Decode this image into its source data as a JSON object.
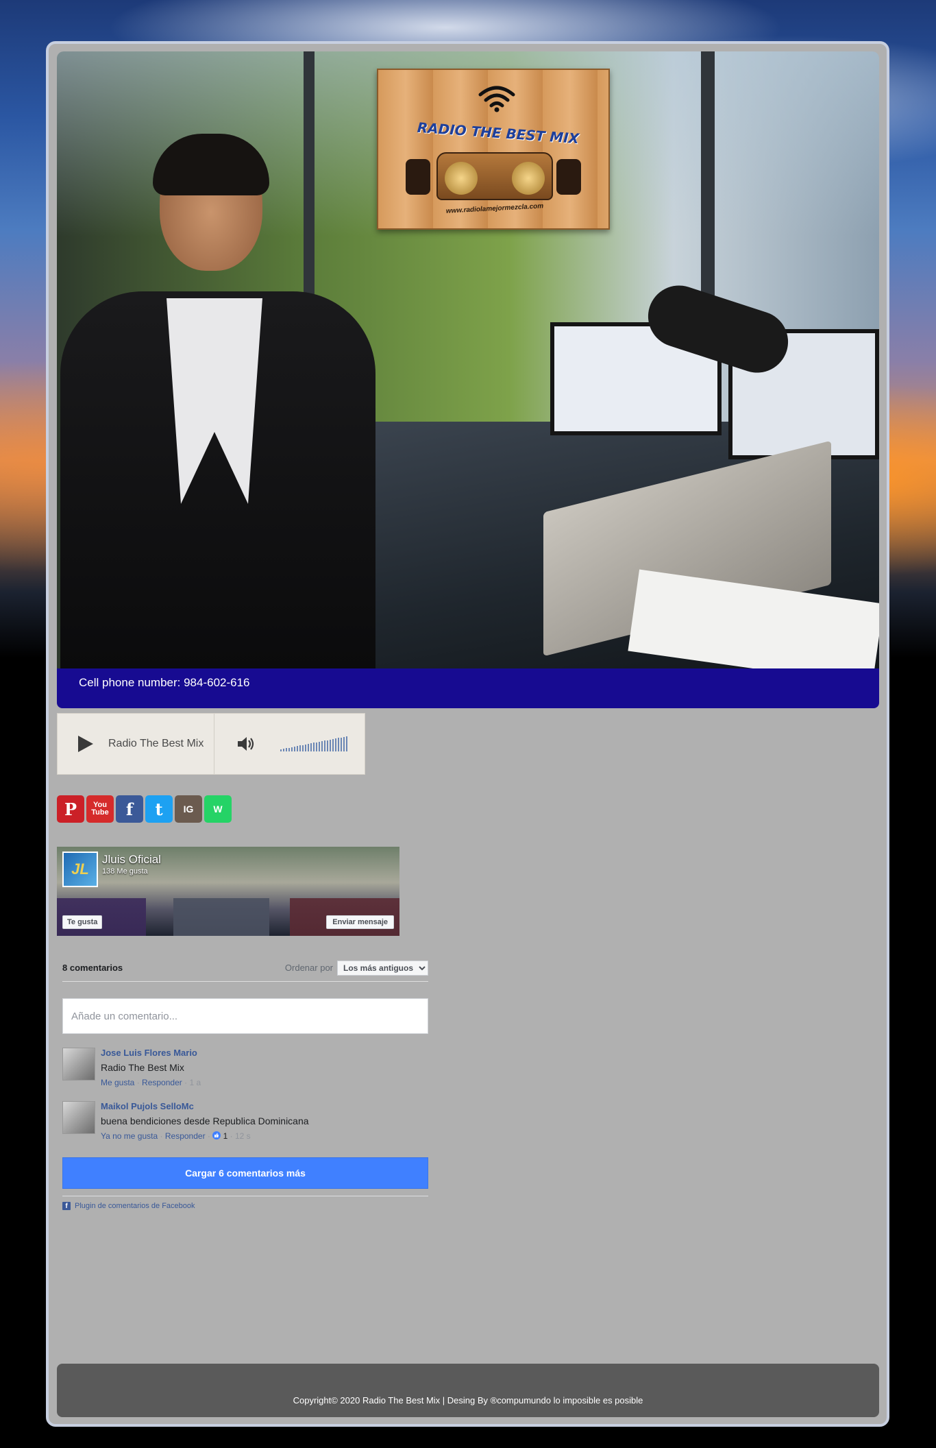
{
  "hero": {
    "sign_title": "RADIO THE BEST MIX",
    "sign_url": "www.radiolamejormezcla.com"
  },
  "contact": {
    "phone_text": "Cell phone number: 984-602-616"
  },
  "player": {
    "station_name": "Radio The Best Mix",
    "volume_level": 1.0
  },
  "social": {
    "buttons": [
      {
        "name": "pinterest",
        "label": "P",
        "color": "#cb2027"
      },
      {
        "name": "youtube",
        "label": "You Tube",
        "color": "#d52b2b"
      },
      {
        "name": "facebook",
        "label": "f",
        "color": "#3b5998"
      },
      {
        "name": "twitter",
        "label": "t",
        "color": "#1da1f2"
      },
      {
        "name": "instagram",
        "label": "IG",
        "color": "#6b5b4f"
      },
      {
        "name": "whatsapp",
        "label": "W",
        "color": "#25d366"
      }
    ]
  },
  "fb_page": {
    "logo_text": "JL",
    "name": "Jluis Oficial",
    "likes": "138 Me gusta",
    "like_button": "Te gusta",
    "message_button": "Enviar mensaje"
  },
  "comments": {
    "count_label": "8 comentarios",
    "order_label": "Ordenar por",
    "order_selected": "Los más antiguos",
    "input_placeholder": "Añade un comentario...",
    "items": [
      {
        "author": "Jose Luis Flores Mario",
        "text": "Radio The Best Mix",
        "like_action": "Me gusta",
        "reply_action": "Responder",
        "reactions": "",
        "time": "1 a"
      },
      {
        "author": "Maikol Pujols SelloMc",
        "text": "buena bendiciones desde Republica Dominicana",
        "like_action": "Ya no me gusta",
        "reply_action": "Responder",
        "reactions": "1",
        "time": "12 s"
      }
    ],
    "load_more": "Cargar 6 comentarios más",
    "plugin_label": "Plugin de comentarios de Facebook"
  },
  "footer": {
    "copyright": "Copyright© 2020 Radio The Best Mix | Desing By ®compumundo lo imposible es posible"
  },
  "colors": {
    "phone_bar": "#170b91",
    "load_more": "#4080ff",
    "frame": "#b0b0b0",
    "footer": "#5a5a5a"
  }
}
